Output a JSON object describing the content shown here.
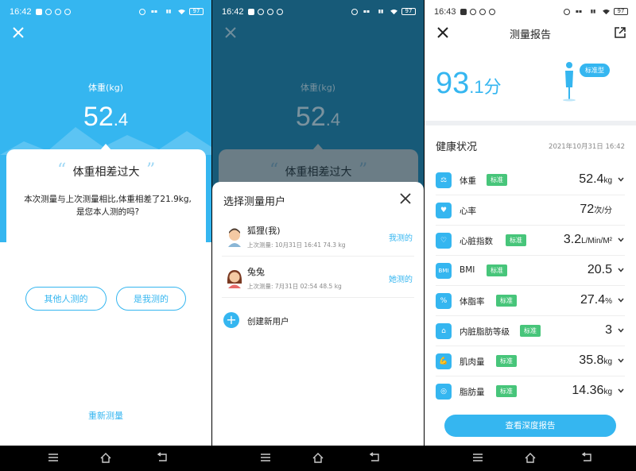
{
  "colors": {
    "accent": "#35b6f0",
    "tag_green": "#47c57a",
    "dark_overlay": "#175a78"
  },
  "screen1": {
    "status": {
      "time": "16:42",
      "battery": "97"
    },
    "weight_label": "体重(kg)",
    "weight_int": "52",
    "weight_dec": ".4",
    "dialog_title": "体重相差过大",
    "dialog_msg": "本次测量与上次测量相比,体重相差了21.9kg,是您本人测的吗?",
    "btn_other": "其他人测的",
    "btn_me": "是我测的",
    "remeasure": "重新测量"
  },
  "screen2": {
    "status": {
      "time": "16:42",
      "battery": "97"
    },
    "weight_label": "体重(kg)",
    "weight_int": "52",
    "weight_dec": ".4",
    "dialog_title": "体重相差过大",
    "sheet_title": "选择测量用户",
    "users": [
      {
        "name": "狐狸(我)",
        "meta": "上次测量: 10月31日 16:41 74.3 kg",
        "action": "我测的"
      },
      {
        "name": "兔兔",
        "meta": "上次测量: 7月31日 02:54 48.5 kg",
        "action": "她测的"
      }
    ],
    "create_user": "创建新用户"
  },
  "screen3": {
    "status": {
      "time": "16:43",
      "battery": "97"
    },
    "title": "测量报告",
    "score_int": "93",
    "score_dec": ".1分",
    "body_type": "标准型",
    "health_title": "健康状况",
    "date": "2021年10月31日 16:42",
    "metrics": [
      {
        "name": "体重",
        "tag": "标准",
        "value": "52.4",
        "unit": "kg",
        "icon": "scale-icon"
      },
      {
        "name": "心率",
        "tag": "",
        "value": "72",
        "unit": "次/分",
        "icon": "heart-rate-icon"
      },
      {
        "name": "心脏指数",
        "tag": "标准",
        "value": "3.2",
        "unit": "L/Min/M²",
        "icon": "heart-index-icon"
      },
      {
        "name": "BMI",
        "tag": "标准",
        "value": "20.5",
        "unit": "",
        "icon": "bmi-icon"
      },
      {
        "name": "体脂率",
        "tag": "标准",
        "value": "27.4",
        "unit": "%",
        "icon": "body-fat-icon"
      },
      {
        "name": "内脏脂肪等级",
        "tag": "标准",
        "value": "3",
        "unit": "",
        "icon": "visceral-fat-icon"
      },
      {
        "name": "肌肉量",
        "tag": "标准",
        "value": "35.8",
        "unit": "kg",
        "icon": "muscle-icon"
      },
      {
        "name": "脂肪量",
        "tag": "标准",
        "value": "14.36",
        "unit": "kg",
        "icon": "fat-mass-icon"
      }
    ],
    "deep_report": "查看深度报告"
  }
}
